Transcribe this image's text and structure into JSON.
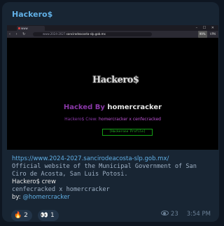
{
  "post": {
    "sender": "Hackero$",
    "caption": {
      "url": "https://www.2024-2027.sancirodeacosta-slp.gob.mx/",
      "description_line1": "Official website of the Municipal Government of San",
      "description_line2": "Ciro de Acosta, San Luis Potosi.",
      "crew": "Hackero$ crew",
      "members": "cenfecracked x homercracker",
      "by_prefix": "by: ",
      "by_handle": "@homercracker"
    },
    "reactions": [
      {
        "icon": "fire-icon",
        "emoji": "🔥",
        "count": "2"
      },
      {
        "icon": "eyes-icon",
        "emoji": "👀",
        "count": "1"
      }
    ],
    "views": "23",
    "time": "3:54 PM"
  },
  "screenshot": {
    "tab_title": "www",
    "window_buttons": "– ☐ ✕",
    "nav_icons": "‹ › ↻",
    "url_prefix": "www.2024-2027.",
    "url_domain": "sancirodeacosta-slp.gob.mx",
    "nav_badge": "99%",
    "vpn_label": "VPN",
    "site": {
      "logo_text": "Hackero$",
      "hacked_prefix": "Hacked By ",
      "hacked_name": "homercracker",
      "crew_prefix": "Hackero$ Crew: ",
      "crew_members": "homercracker x cenfecracked",
      "profile_link": "[Hackerone Profile]"
    }
  },
  "colors": {
    "background": "#0e1621",
    "bubble": "#182533",
    "link": "#61b0e6",
    "hacked_purple": "#8a38a8",
    "profile_green": "#27c027"
  }
}
